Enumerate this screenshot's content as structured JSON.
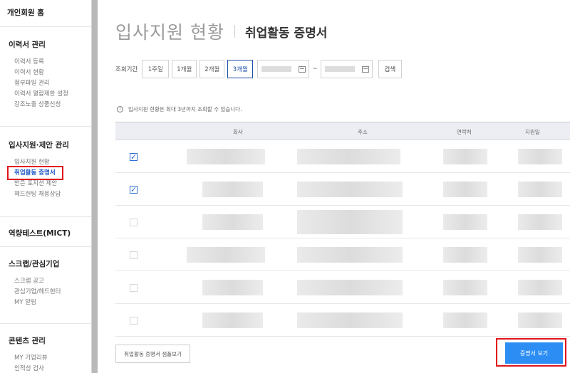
{
  "sidebar": {
    "top": "개인회원 홈",
    "sections": [
      {
        "head": "이력서 관리",
        "items": [
          "이력서 등록",
          "이력서 현황",
          "첨부파일 관리",
          "이력서 열람제한 설정",
          "강조노출 상품신청"
        ]
      },
      {
        "head": "입사지원·제안 관리",
        "items": [
          "입사지원 현황",
          "취업활동 증명서",
          "받은 포지션 제안",
          "헤드헌팅 채용상담"
        ]
      },
      {
        "head": "역량테스트(MICT)",
        "items": []
      },
      {
        "head": "스크랩/관심기업",
        "items": [
          "스크랩 공고",
          "관심기업/헤드헌터",
          "MY 알림"
        ]
      },
      {
        "head": "콘텐츠 관리",
        "items": [
          "MY 기업리뷰",
          "인적성 검사"
        ]
      }
    ]
  },
  "header": {
    "title": "입사지원 현황",
    "subtitle": "취업활동 증명서"
  },
  "filter": {
    "label": "조회기간",
    "periods": [
      "1주일",
      "1개월",
      "2개월",
      "3개월"
    ],
    "active_period": "3개월",
    "tilde": "~",
    "search_label": "검색"
  },
  "notice": {
    "icon": "!",
    "text": "입사지원 현황은 최대 3년까지 조회할 수 있습니다."
  },
  "table": {
    "columns": [
      "회사",
      "주소",
      "연락처",
      "지원일"
    ],
    "rows": [
      {
        "checked": true
      },
      {
        "checked": true
      },
      {
        "checked": false
      },
      {
        "checked": false
      },
      {
        "checked": false
      },
      {
        "checked": false
      }
    ]
  },
  "buttons": {
    "sample": "취업활동 증명서 샘플보기",
    "certificate": "증명서 보기"
  },
  "colors": {
    "accent": "#2c8ef4",
    "highlight": "#e0141b",
    "active_nav": "#1a57c5"
  },
  "icons": {
    "check": "✓",
    "calendar": "calendar-icon",
    "info": "info-icon"
  }
}
